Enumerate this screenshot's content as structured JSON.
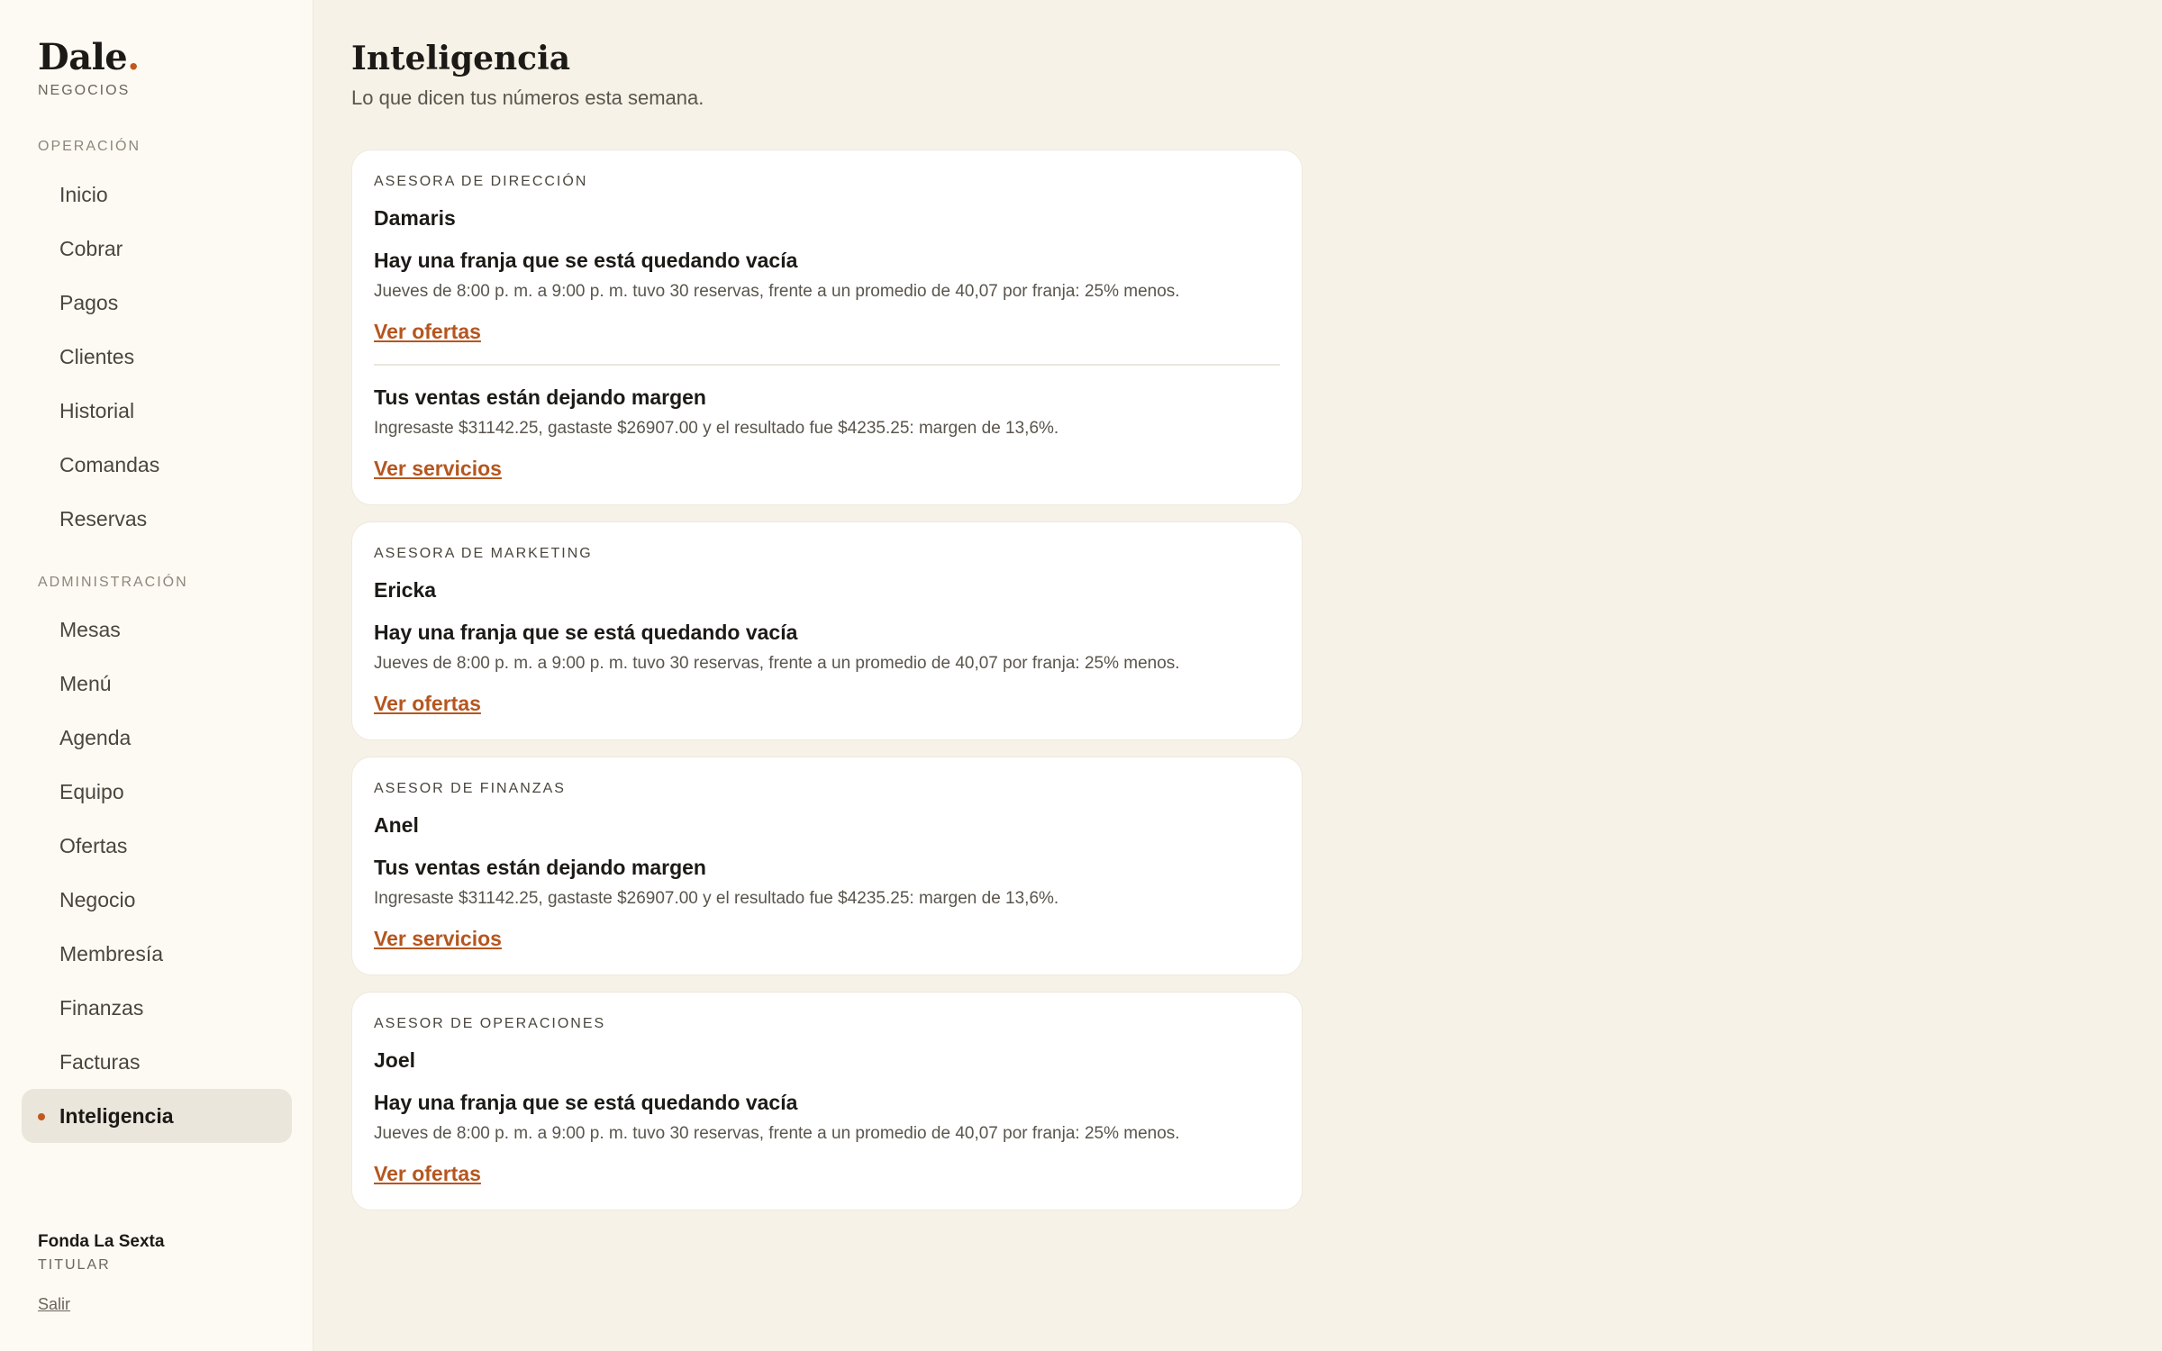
{
  "brand": {
    "name": "Dale",
    "dot": ".",
    "subtitle": "NEGOCIOS"
  },
  "sidebar": {
    "sections": [
      {
        "label": "OPERACIÓN",
        "items": [
          {
            "label": "Inicio"
          },
          {
            "label": "Cobrar"
          },
          {
            "label": "Pagos"
          },
          {
            "label": "Clientes"
          },
          {
            "label": "Historial"
          },
          {
            "label": "Comandas"
          },
          {
            "label": "Reservas"
          }
        ]
      },
      {
        "label": "ADMINISTRACIÓN",
        "items": [
          {
            "label": "Mesas"
          },
          {
            "label": "Menú"
          },
          {
            "label": "Agenda"
          },
          {
            "label": "Equipo"
          },
          {
            "label": "Ofertas"
          },
          {
            "label": "Negocio"
          },
          {
            "label": "Membresía"
          },
          {
            "label": "Finanzas"
          },
          {
            "label": "Facturas"
          },
          {
            "label": "Inteligencia",
            "active": true
          }
        ]
      }
    ],
    "account": {
      "name": "Fonda La Sexta",
      "role": "TITULAR",
      "logout": "Salir"
    }
  },
  "header": {
    "title": "Inteligencia",
    "subtitle": "Lo que dicen tus números esta semana."
  },
  "cards": [
    {
      "role": "ASESORA DE DIRECCIÓN",
      "name": "Damaris",
      "insights": [
        {
          "title": "Hay una franja que se está quedando vacía",
          "body": "Jueves de 8:00 p. m. a 9:00 p. m. tuvo 30 reservas, frente a un promedio de 40,07 por franja: 25% menos.",
          "link": "Ver ofertas"
        },
        {
          "title": "Tus ventas están dejando margen",
          "body": "Ingresaste $31142.25, gastaste $26907.00 y el resultado fue $4235.25: margen de 13,6%.",
          "link": "Ver servicios"
        }
      ]
    },
    {
      "role": "ASESORA DE MARKETING",
      "name": "Ericka",
      "insights": [
        {
          "title": "Hay una franja que se está quedando vacía",
          "body": "Jueves de 8:00 p. m. a 9:00 p. m. tuvo 30 reservas, frente a un promedio de 40,07 por franja: 25% menos.",
          "link": "Ver ofertas"
        }
      ]
    },
    {
      "role": "ASESOR DE FINANZAS",
      "name": "Anel",
      "insights": [
        {
          "title": "Tus ventas están dejando margen",
          "body": "Ingresaste $31142.25, gastaste $26907.00 y el resultado fue $4235.25: margen de 13,6%.",
          "link": "Ver servicios"
        }
      ]
    },
    {
      "role": "ASESOR DE OPERACIONES",
      "name": "Joel",
      "insights": [
        {
          "title": "Hay una franja que se está quedando vacía",
          "body": "Jueves de 8:00 p. m. a 9:00 p. m. tuvo 30 reservas, frente a un promedio de 40,07 por franja: 25% menos.",
          "link": "Ver ofertas"
        }
      ]
    }
  ],
  "colors": {
    "accent": "#c2581e",
    "link": "#b5561f",
    "background": "#f6f2e8",
    "sidebar": "#fdfaf3"
  }
}
